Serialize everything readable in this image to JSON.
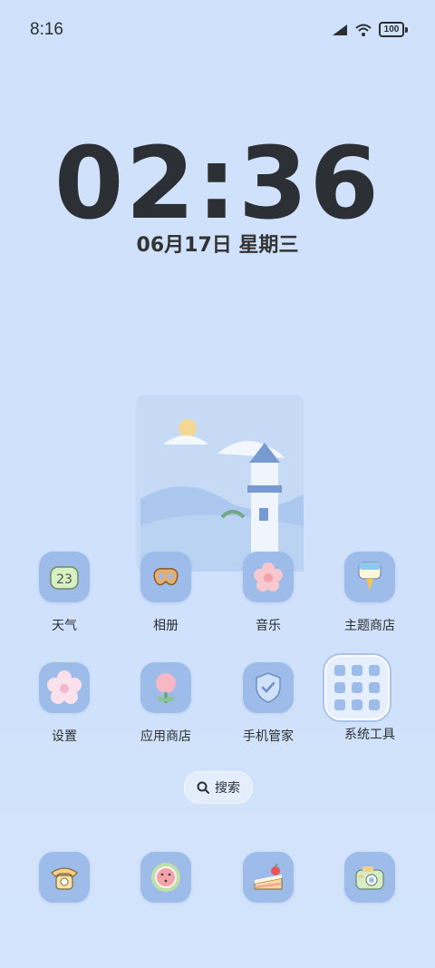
{
  "status": {
    "time": "8:16",
    "battery": "100"
  },
  "lockclock": {
    "time": "02:36",
    "date": "06月17日 星期三"
  },
  "apps_row1": [
    {
      "label": "天气",
      "icon": "weather-icon",
      "temp": "23"
    },
    {
      "label": "相册",
      "icon": "pretzel-icon"
    },
    {
      "label": "音乐",
      "icon": "flower-icon"
    },
    {
      "label": "主题商店",
      "icon": "popsicle-icon"
    }
  ],
  "apps_row2": [
    {
      "label": "设置",
      "icon": "daisy-icon"
    },
    {
      "label": "应用商店",
      "icon": "tulip-icon"
    },
    {
      "label": "手机管家",
      "icon": "shield-icon"
    },
    {
      "label": "系统工具",
      "icon": "folder-grid-icon"
    }
  ],
  "dock": [
    {
      "icon": "telephone-icon"
    },
    {
      "icon": "watermelon-icon"
    },
    {
      "icon": "cake-icon"
    },
    {
      "icon": "camera-icon"
    }
  ],
  "search": {
    "label": "搜索"
  },
  "colors": {
    "background": "#cfe1fb",
    "icon_tile": "#9dbce9",
    "text": "#2c2f33"
  }
}
